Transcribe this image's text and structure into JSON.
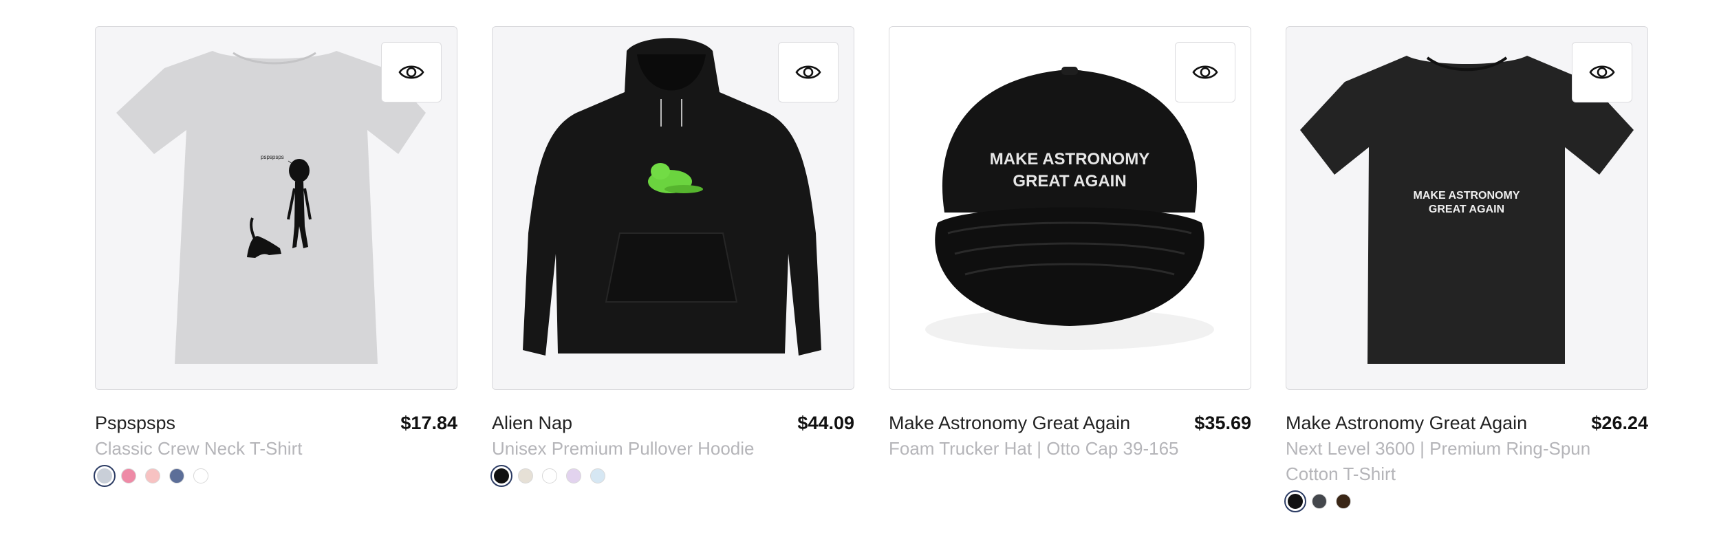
{
  "products": [
    {
      "title": "Pspspsps",
      "price": "$17.84",
      "subtitle": "Classic Crew Neck T-Shirt",
      "image_text": "pspspsps",
      "swatches": [
        "#c9cfd8",
        "#ee8aa6",
        "#f7c2c2",
        "#5c6e98",
        "#ffffff"
      ]
    },
    {
      "title": "Alien Nap",
      "price": "$44.09",
      "subtitle": "Unisex Premium Pullover Hoodie",
      "swatches": [
        "#111111",
        "#e6e0d6",
        "#ffffff",
        "#e2d3ee",
        "#d6e7f3"
      ]
    },
    {
      "title": "Make Astronomy Great Again",
      "price": "$35.69",
      "subtitle": "Foam Trucker Hat | Otto Cap 39-165",
      "image_text_line1": "MAKE ASTRONOMY",
      "image_text_line2": "GREAT AGAIN",
      "swatches": []
    },
    {
      "title": "Make Astronomy Great Again",
      "price": "$26.24",
      "subtitle": "Next Level 3600 | Premium Ring-Spun Cotton T-Shirt",
      "image_text_line1": "MAKE ASTRONOMY",
      "image_text_line2": "GREAT AGAIN",
      "swatches": [
        "#111111",
        "#44474c",
        "#3a2616"
      ]
    }
  ],
  "icons": {
    "quick_view": "eye-icon"
  }
}
